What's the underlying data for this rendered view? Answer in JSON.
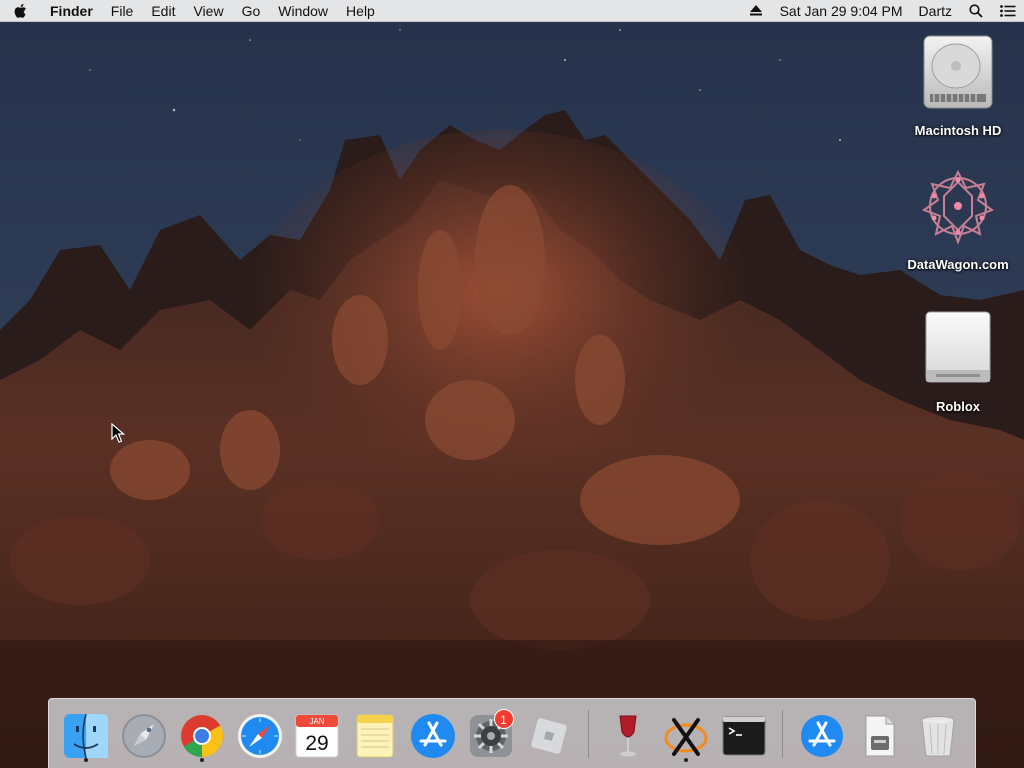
{
  "menubar": {
    "apple_icon": "apple-logo-icon",
    "app_name": "Finder",
    "menus": [
      "File",
      "Edit",
      "View",
      "Go",
      "Window",
      "Help"
    ],
    "status_icons": [
      "eject-icon",
      "search-icon",
      "list-icon"
    ],
    "clock": "Sat Jan 29  9:04 PM",
    "user": "Dartz"
  },
  "desktop": {
    "icons": [
      {
        "label": "Macintosh HD",
        "icon": "hard-drive-icon"
      },
      {
        "label": "DataWagon.com",
        "icon": "network-volume-icon"
      },
      {
        "label": "Roblox",
        "icon": "removable-disk-icon"
      }
    ]
  },
  "dock": {
    "items": [
      {
        "name": "Finder",
        "icon": "finder-icon",
        "running": true
      },
      {
        "name": "Launchpad",
        "icon": "launchpad-icon",
        "running": false
      },
      {
        "name": "Google Chrome",
        "icon": "chrome-icon",
        "running": true
      },
      {
        "name": "Safari",
        "icon": "safari-icon",
        "running": false
      },
      {
        "name": "Calendar",
        "icon": "calendar-icon",
        "running": false,
        "month": "JAN",
        "day": "29"
      },
      {
        "name": "Notes",
        "icon": "notes-icon",
        "running": false
      },
      {
        "name": "App Store",
        "icon": "app-store-icon",
        "running": false
      },
      {
        "name": "System Preferences",
        "icon": "system-preferences-icon",
        "running": false,
        "badge": "1"
      },
      {
        "name": "Roblox",
        "icon": "roblox-icon",
        "running": false
      },
      {
        "name": "Wine",
        "icon": "wine-icon",
        "running": false
      },
      {
        "name": "XQuartz",
        "icon": "xquartz-icon",
        "running": true
      },
      {
        "name": "Terminal",
        "icon": "terminal-icon",
        "running": false
      },
      {
        "name": "Downloads",
        "icon": "app-store-downloads-icon",
        "running": false
      },
      {
        "name": "Installer",
        "icon": "installer-icon",
        "running": false
      },
      {
        "name": "Trash",
        "icon": "trash-icon",
        "running": false
      }
    ]
  },
  "colors": {
    "menubar_bg": "#ececec",
    "badge": "#f03b30",
    "accent_blue": "#1f8bf2"
  }
}
